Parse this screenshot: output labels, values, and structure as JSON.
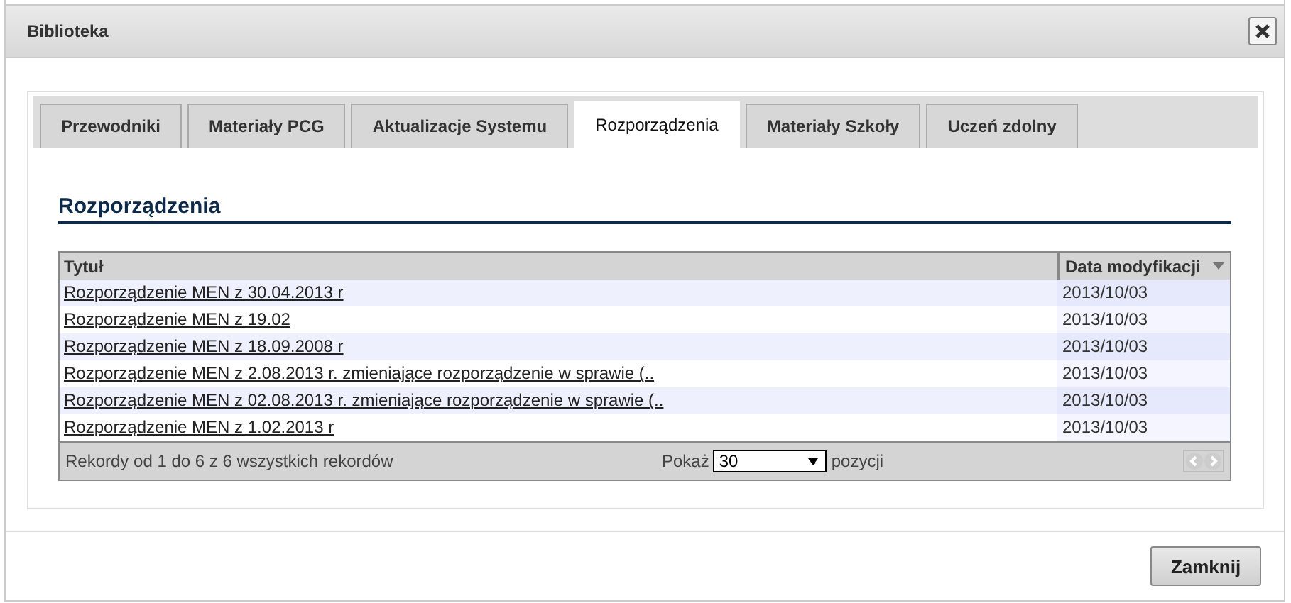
{
  "window": {
    "title": "Biblioteka"
  },
  "tabs": [
    {
      "label": "Przewodniki",
      "selected": false
    },
    {
      "label": "Materiały PCG",
      "selected": false
    },
    {
      "label": "Aktualizacje Systemu",
      "selected": false
    },
    {
      "label": "Rozporządzenia",
      "selected": true
    },
    {
      "label": "Materiały Szkoły",
      "selected": false
    },
    {
      "label": "Uczeń zdolny",
      "selected": false
    }
  ],
  "section_title": "Rozporządzenia",
  "table": {
    "columns": [
      {
        "label": "Tytuł",
        "sorted": false
      },
      {
        "label": "Data modyfikacji",
        "sorted": true
      }
    ],
    "rows": [
      {
        "title": "Rozporządzenie MEN z 30.04.2013 r",
        "date": "2013/10/03"
      },
      {
        "title": "Rozporządzenie MEN z 19.02",
        "date": "2013/10/03"
      },
      {
        "title": "Rozporządzenie MEN z 18.09.2008 r",
        "date": "2013/10/03"
      },
      {
        "title": "Rozporządzenie MEN z 2.08.2013 r. zmieniające rozporządzenie w sprawie (..",
        "date": "2013/10/03"
      },
      {
        "title": "Rozporządzenie MEN z 02.08.2013 r. zmieniające rozporządzenie w sprawie (..",
        "date": "2013/10/03"
      },
      {
        "title": "Rozporządzenie MEN z 1.02.2013 r",
        "date": "2013/10/03"
      }
    ],
    "footer": {
      "info": "Rekordy od 1 do 6 z 6 wszystkich rekordów",
      "show_label": "Pokaż",
      "page_size": "30",
      "unit": "pozycji"
    }
  },
  "buttons": [
    "Zamknij"
  ]
}
